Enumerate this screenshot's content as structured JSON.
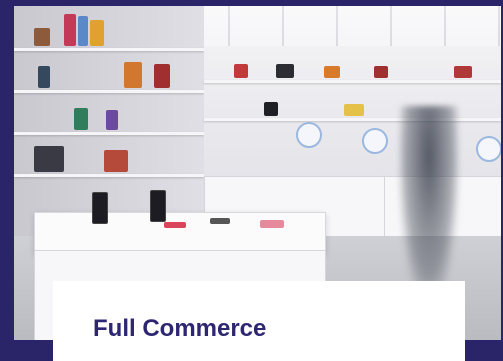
{
  "card": {
    "title": "Full Commerce"
  },
  "image": {
    "subject": "retail-store-photo"
  },
  "colors": {
    "frame_background": "#2a2468",
    "card_background": "#ffffff",
    "title_text": "#2d2670"
  }
}
